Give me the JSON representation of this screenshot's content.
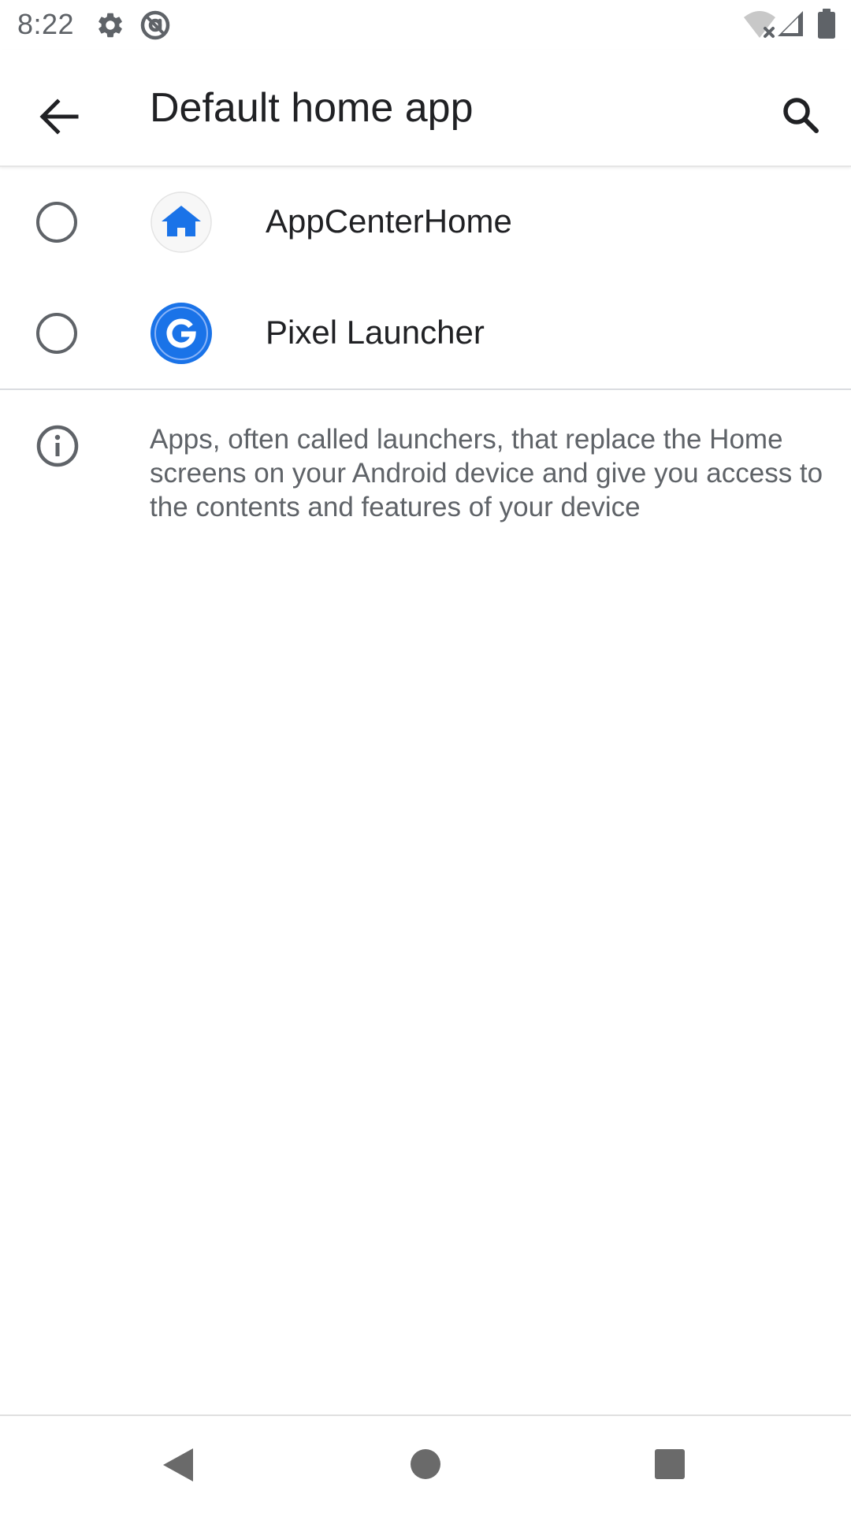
{
  "status_bar": {
    "time": "8:22",
    "icons": [
      "settings-gear-icon",
      "at-sign-icon",
      "wifi-off-icon",
      "cell-signal-icon",
      "battery-icon"
    ]
  },
  "app_bar": {
    "title": "Default home app",
    "back_icon": "arrow-back-icon",
    "search_icon": "search-icon"
  },
  "apps": [
    {
      "label": "AppCenterHome",
      "icon": "house-icon",
      "selected": false
    },
    {
      "label": "Pixel Launcher",
      "icon": "google-g-icon",
      "selected": false
    }
  ],
  "footer": {
    "icon": "info-icon",
    "text": "Apps, often called launchers, that replace the Home screens on your Android device and give you access to the contents and features of your device"
  },
  "nav_bar": {
    "icons": [
      "back-triangle-icon",
      "home-circle-icon",
      "recents-square-icon"
    ]
  },
  "colors": {
    "accent_blue": "#1a73e8",
    "icon_gray": "#5f6368",
    "text_primary": "#202124"
  }
}
